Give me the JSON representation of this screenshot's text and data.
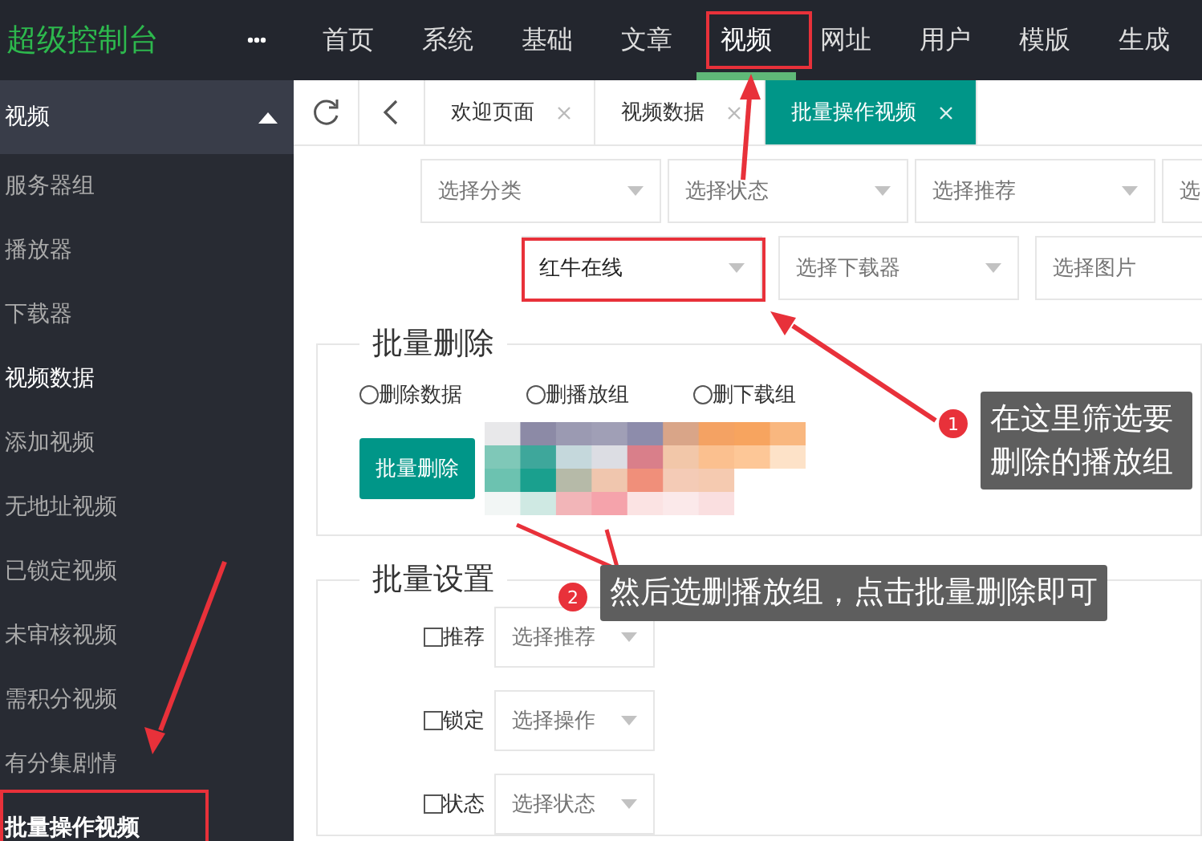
{
  "app": {
    "title": "超级控制台"
  },
  "top_nav": [
    {
      "label": "首页",
      "selected": false
    },
    {
      "label": "系统",
      "selected": false
    },
    {
      "label": "基础",
      "selected": false
    },
    {
      "label": "文章",
      "selected": false
    },
    {
      "label": "视频",
      "selected": true
    },
    {
      "label": "网址",
      "selected": false
    },
    {
      "label": "用户",
      "selected": false
    },
    {
      "label": "模版",
      "selected": false
    },
    {
      "label": "生成",
      "selected": false
    }
  ],
  "sidebar": {
    "header": "视频",
    "expanded": true,
    "items": [
      {
        "label": "服务器组",
        "selected": false,
        "emphasized": false
      },
      {
        "label": "播放器",
        "selected": false,
        "emphasized": false
      },
      {
        "label": "下载器",
        "selected": false,
        "emphasized": false
      },
      {
        "label": "视频数据",
        "selected": false,
        "emphasized": true
      },
      {
        "label": "添加视频",
        "selected": false,
        "emphasized": false
      },
      {
        "label": "无地址视频",
        "selected": false,
        "emphasized": false
      },
      {
        "label": "已锁定视频",
        "selected": false,
        "emphasized": false
      },
      {
        "label": "未审核视频",
        "selected": false,
        "emphasized": false
      },
      {
        "label": "需积分视频",
        "selected": false,
        "emphasized": false
      },
      {
        "label": "有分集剧情",
        "selected": false,
        "emphasized": false
      },
      {
        "label": "批量操作视频",
        "selected": true,
        "emphasized": false
      }
    ]
  },
  "tabs": [
    {
      "label": "欢迎页面",
      "selected": false
    },
    {
      "label": "视频数据",
      "selected": false
    },
    {
      "label": "批量操作视频",
      "selected": true
    }
  ],
  "filters": {
    "row_1": [
      {
        "placeholder": "选择分类"
      },
      {
        "placeholder": "选择状态"
      },
      {
        "placeholder": "选择推荐"
      },
      {
        "placeholder": "选"
      }
    ],
    "row_2": [
      {
        "value": "红牛在线"
      },
      {
        "placeholder": "选择下载器"
      },
      {
        "placeholder": "选择图片"
      }
    ]
  },
  "batch_delete": {
    "legend": "批量删除",
    "options": [
      {
        "label": "删除数据",
        "selected": false
      },
      {
        "label": "删播放组",
        "selected": false
      },
      {
        "label": "删下载组",
        "selected": false
      }
    ],
    "button": "批量删除"
  },
  "batch_settings": {
    "legend": "批量设置",
    "rows": [
      {
        "label": "推荐",
        "checked": false,
        "placeholder": "选择推荐"
      },
      {
        "label": "锁定",
        "checked": false,
        "placeholder": "选择操作"
      },
      {
        "label": "状态",
        "checked": false,
        "placeholder": "选择状态"
      }
    ]
  },
  "annotations": [
    {
      "number": "1",
      "text": "在这里筛选要删除的播放组"
    },
    {
      "number": "2",
      "text": "然后选删播放组，点击批量删除即可"
    }
  ]
}
